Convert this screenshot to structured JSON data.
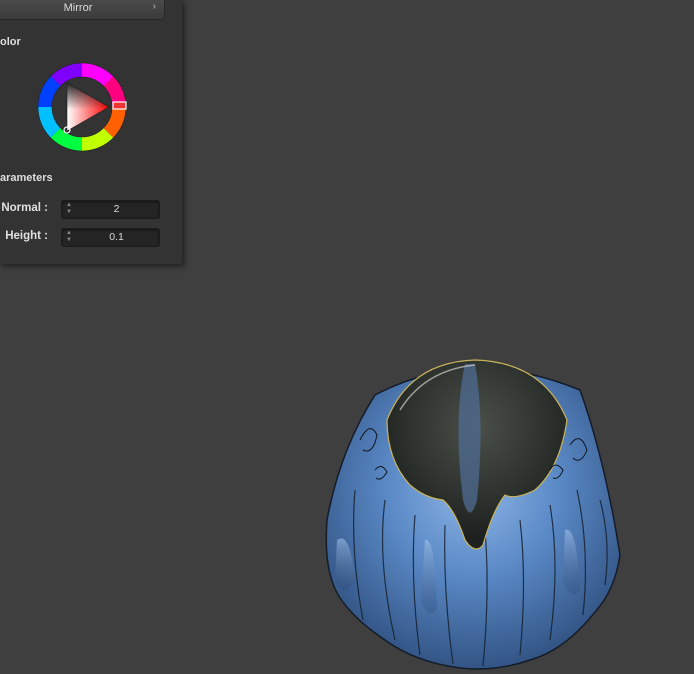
{
  "panel": {
    "mirror_label": "Mirror",
    "chevron_icon": "chevron-right-icon",
    "color_section_title": "olor",
    "color_picker": {
      "hue_hex": "#ff0000",
      "marker_icon": "hue-marker"
    },
    "parameters_section_title": "arameters",
    "params": [
      {
        "label": "Normal :",
        "value": "2"
      },
      {
        "label": "Height :",
        "value": "0.1"
      }
    ]
  },
  "viewport": {
    "background": "#3f3f3f",
    "object_icon": "draped-cloth-mesh",
    "object_colors": [
      "#5b8ccc",
      "#2f4e7a",
      "#3a3f3a"
    ]
  }
}
